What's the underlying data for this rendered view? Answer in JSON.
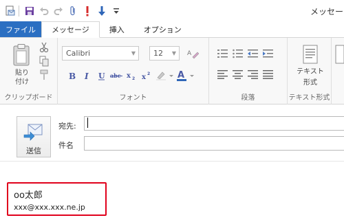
{
  "window": {
    "title": "メッセージ"
  },
  "tabs": [
    {
      "label": "ファイル"
    },
    {
      "label": "メッセージ"
    },
    {
      "label": "挿入"
    },
    {
      "label": "オプション"
    }
  ],
  "ribbon": {
    "clipboard": {
      "paste_label_1": "貼り",
      "paste_label_2": "付け",
      "group_label": "クリップボード"
    },
    "font": {
      "font_name": "Calibri",
      "font_size": "12",
      "group_label": "フォント"
    },
    "paragraph": {
      "group_label": "段落"
    },
    "text_format": {
      "button_label_1": "テキスト",
      "button_label_2": "形式",
      "group_label": "テキスト形式"
    }
  },
  "compose": {
    "send_label": "送信",
    "to_label": "宛先:",
    "to_value": "",
    "subject_label": "件名",
    "subject_value": ""
  },
  "body": {
    "signature_name": "oo太郎",
    "signature_email": "xxx@xxx.xxx.ne.jp"
  },
  "colors": {
    "file_tab": "#2b6fc2",
    "highlight_border": "#e0001b"
  }
}
